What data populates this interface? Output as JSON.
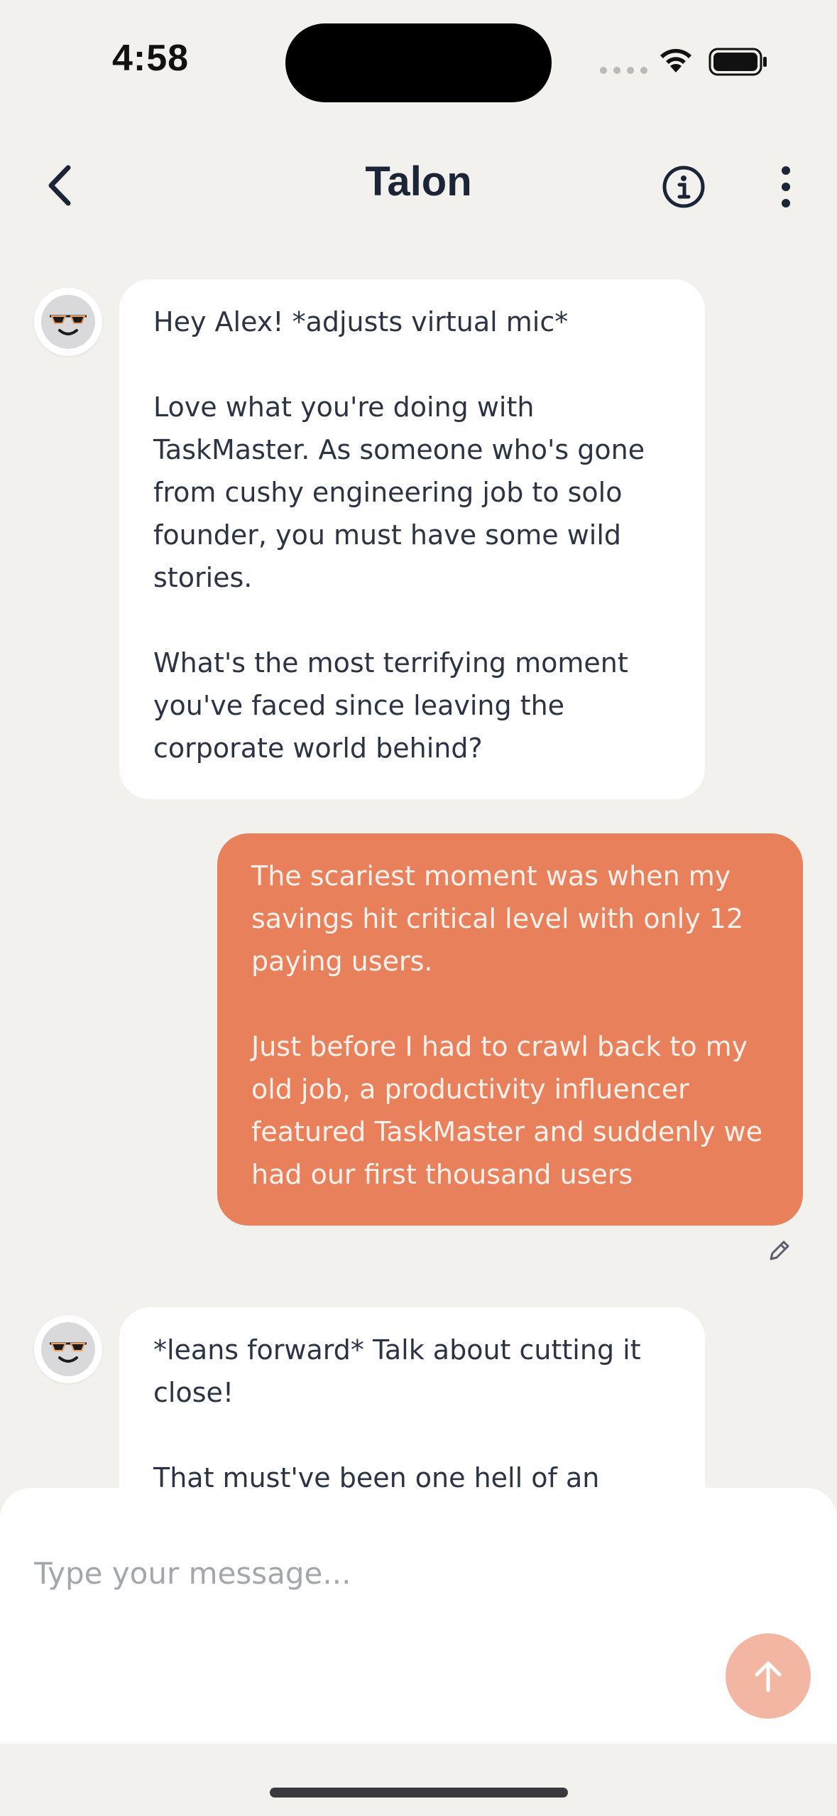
{
  "status_bar": {
    "time": "4:58"
  },
  "header": {
    "title": "Talon",
    "back_icon": "chevron-left-icon",
    "info_icon": "info-circle-icon",
    "more_icon": "more-vertical-icon"
  },
  "messages": [
    {
      "sender": "assistant",
      "text": "Hey Alex! *adjusts virtual mic*\n\nLove what you're doing with TaskMaster. As someone who's gone from cushy engineering job to solo founder, you must have some wild stories.\n\nWhat's the most terrifying moment you've faced since leaving the corporate world behind?"
    },
    {
      "sender": "user",
      "text": "The scariest moment was when my savings hit critical level with only 12 paying users.\n\nJust before I had to crawl back to my old job, a productivity influencer featured TaskMaster and suddenly we had our first thousand users"
    },
    {
      "sender": "assistant",
      "text": "*leans forward* Talk about cutting it close!\n\nThat must've been one hell of an"
    }
  ],
  "composer": {
    "placeholder": "Type your message...",
    "send_icon": "arrow-up-icon"
  },
  "colors": {
    "background": "#f2f1ee",
    "user_bubble": "#e9805c",
    "assistant_bubble": "#ffffff",
    "send_button": "#f2b6a3"
  }
}
